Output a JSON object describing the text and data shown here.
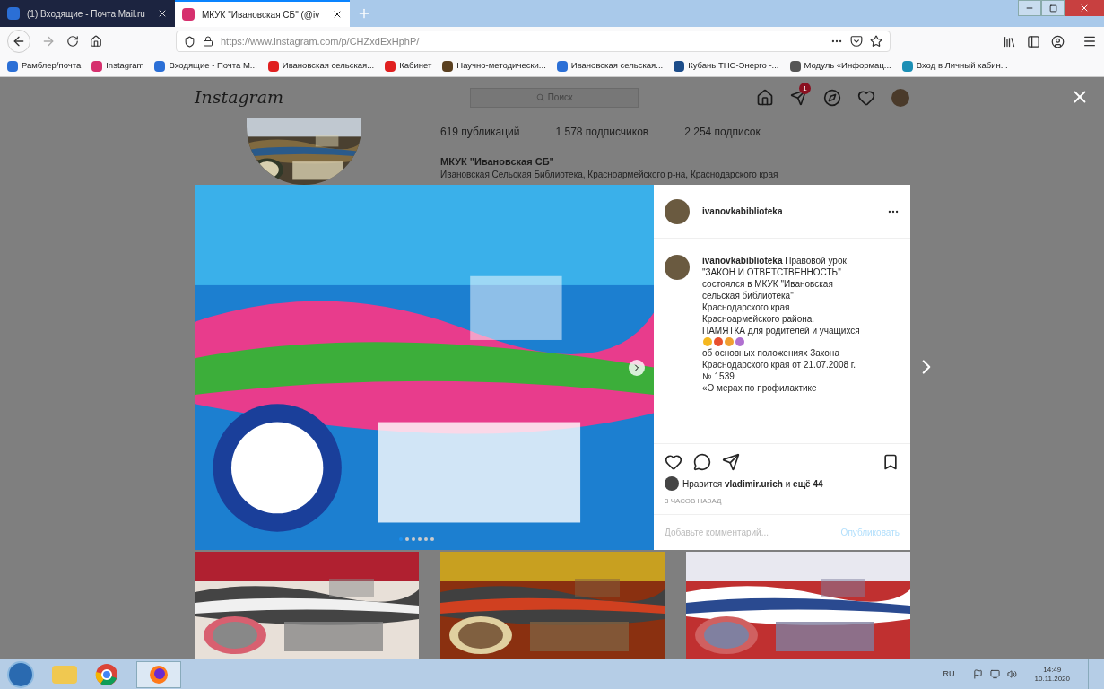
{
  "browser": {
    "tabs": [
      {
        "title": "(1) Входящие - Почта Mail.ru",
        "selected": false,
        "color": "#2b6fd6"
      },
      {
        "title": "МКУК \"Ивановская СБ\" (@iv",
        "selected": true,
        "color": "#d6306e"
      }
    ],
    "url": "https://www.instagram.com/p/CHZxdExHphP/",
    "bookmarks": [
      {
        "title": "Рамблер/почта",
        "color": "#2b6fd6"
      },
      {
        "title": "Instagram",
        "color": "#d6306e"
      },
      {
        "title": "Входящие - Почта М...",
        "color": "#2b6fd6"
      },
      {
        "title": "Ивановская сельская...",
        "color": "#e02020"
      },
      {
        "title": "Кабинет",
        "color": "#e02020"
      },
      {
        "title": "Научно-методически...",
        "color": "#5a4020"
      },
      {
        "title": "Ивановская сельская...",
        "color": "#2b6fd6"
      },
      {
        "title": "Кубань ТНС-Энерго -...",
        "color": "#1d4d8a"
      },
      {
        "title": "Модуль «Информац...",
        "color": "#555555"
      },
      {
        "title": "Вход в Личный кабин...",
        "color": "#1c8fb5"
      }
    ]
  },
  "instagram": {
    "logo": "Instagram",
    "search": {
      "placeholder": "Поиск"
    },
    "notification_count": "1",
    "profile": {
      "stats": [
        "619 публикаций",
        "1 578 подписчиков",
        "2 254 подписок"
      ],
      "name": "МКУК \"Ивановская СБ\"",
      "bio": "Ивановская Сельская Библиотека, Красноармейского р-на, Краснодарского края"
    }
  },
  "post": {
    "username": "ivanovkabiblioteka",
    "carousel_dots": [
      {
        "selected": true
      },
      {
        "selected": false
      },
      {
        "selected": false
      },
      {
        "selected": false
      },
      {
        "selected": false
      },
      {
        "selected": false
      }
    ],
    "caption_start": "**ivanovkabiblioteka** Правовой урок\n\"ЗАКОН И ОТВЕТСТВЕННОСТЬ\"\nсостоялся в МКУК \"Ивановская\nсельская библиотека\"\nКраснодарского края\nКрасноармейского района.\nПАМЯТКА для родителей и учащихся",
    "caption_end": "об основных положениях Закона\nКраснодарского края от 21.07.2008 г.\n№ 1539\n«О мерах по профилактике",
    "likes": "Нравится **vladimir.urich** и **ещё 44**",
    "time": "3 ЧАСОВ НАЗАД",
    "comment": {
      "placeholder": "Добавьте комментарий..."
    },
    "publish": {
      "label": "Опубликовать",
      "disabled": true
    }
  },
  "taskbar": {
    "language": "RU",
    "time": "14:49",
    "date": "10.11.2020"
  }
}
